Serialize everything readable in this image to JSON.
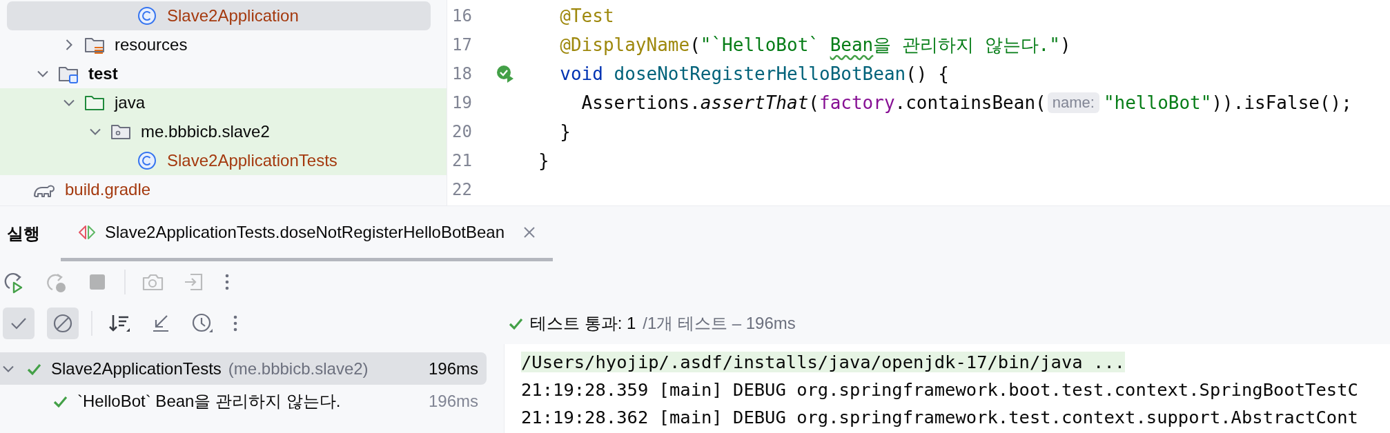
{
  "project_tree": {
    "items": [
      {
        "children": [
          {
            "children": [
              {
                "children": [
                  {
                    "children": [
                      {
                        "label": "Slave2Application",
                        "kind": "class",
                        "selected": true,
                        "highlighted": false,
                        "color": "#a4390e"
                      }
                    ]
                  }
                ]
              },
              {
                "label": "resources",
                "kind": "resources-folder",
                "expanded": false,
                "selected": false,
                "highlighted": false,
                "color": "#080808"
              }
            ]
          },
          {
            "label": "test",
            "kind": "test-folder",
            "expanded": true,
            "selected": false,
            "highlighted": false,
            "color": "#080808",
            "children": [
              {
                "label": "java",
                "kind": "source-folder",
                "expanded": true,
                "selected": false,
                "highlighted": true,
                "color": "#080808",
                "children": [
                  {
                    "label": "me.bbbicb.slave2",
                    "kind": "package",
                    "expanded": true,
                    "selected": false,
                    "highlighted": true,
                    "color": "#080808",
                    "children": [
                      {
                        "label": "Slave2ApplicationTests",
                        "kind": "class",
                        "selected": false,
                        "highlighted": true,
                        "color": "#a4390e"
                      }
                    ]
                  }
                ]
              }
            ]
          }
        ]
      },
      {
        "label": "build.gradle",
        "kind": "gradle",
        "selected": false,
        "highlighted": false,
        "color": "#a4390e"
      }
    ]
  },
  "editor": {
    "lines": [
      {
        "children": [
          {
            "number": "16",
            "tokens": [
              {
                "kind": "annotation",
                "text": "@Test"
              }
            ]
          },
          {
            "number": "17",
            "tokens": [
              {
                "kind": "annotation",
                "text": "@DisplayName"
              },
              {
                "kind": "plain",
                "text": "("
              },
              {
                "kind": "string",
                "text": "\"`HelloBot` "
              },
              {
                "kind": "string",
                "text": "Bean",
                "typo": true
              },
              {
                "kind": "string",
                "text": "을 관리하지 않는다.\""
              },
              {
                "kind": "plain",
                "text": ")"
              }
            ]
          },
          {
            "number": "18",
            "run_marker": true,
            "tokens": [
              {
                "kind": "keyword",
                "text": "void"
              },
              {
                "kind": "method",
                "text": " doseNotRegisterHelloBotBean"
              },
              {
                "kind": "plain",
                "text": "() {"
              }
            ],
            "children": [
              {
                "number": "19",
                "tokens": [
                  {
                    "kind": "plain",
                    "text": "Assertions."
                  },
                  {
                    "kind": "static-call",
                    "text": "assertThat"
                  },
                  {
                    "kind": "plain",
                    "text": "("
                  },
                  {
                    "kind": "field",
                    "text": "factory"
                  },
                  {
                    "kind": "plain",
                    "text": ".containsBean("
                  },
                  {
                    "kind": "hint",
                    "text": "name:"
                  },
                  {
                    "kind": "string",
                    "text": "\"helloBot\""
                  },
                  {
                    "kind": "plain",
                    "text": ")).isFalse();"
                  }
                ]
              }
            ]
          },
          {
            "number": "20",
            "tokens": [
              {
                "kind": "plain",
                "text": "}"
              }
            ]
          }
        ]
      },
      {
        "number": "21",
        "tokens": [
          {
            "kind": "plain",
            "text": "}"
          }
        ]
      },
      {
        "number": "22"
      }
    ]
  },
  "run_panel": {
    "title": "실행",
    "tab": {
      "label": "Slave2ApplicationTests.doseNotRegisterHelloBotBean",
      "selected": true
    },
    "toolbar": [
      {
        "kind": "rerun",
        "disabled": false
      },
      {
        "kind": "rerun-failed",
        "disabled": true
      },
      {
        "kind": "stop",
        "disabled": true
      },
      {
        "kind": "separator"
      },
      {
        "kind": "screenshot",
        "disabled": true
      },
      {
        "kind": "export",
        "disabled": true
      },
      {
        "kind": "more",
        "disabled": false
      }
    ],
    "filter_toolbar": [
      {
        "kind": "show-passed",
        "toggled": true
      },
      {
        "kind": "show-ignored",
        "toggled": true
      },
      {
        "kind": "separator"
      },
      {
        "kind": "sort",
        "toggled": false
      },
      {
        "kind": "collapse",
        "toggled": false
      },
      {
        "kind": "history",
        "toggled": false
      },
      {
        "kind": "more",
        "toggled": false
      }
    ],
    "status": {
      "passed": true,
      "summary": "테스트 통과: 1",
      "detail": "/1개 테스트 – 196ms"
    },
    "tests": [
      {
        "label": "Slave2ApplicationTests",
        "package": "(me.bbbicb.slave2)",
        "duration": "196ms",
        "passed": true,
        "expanded": true,
        "selected": true,
        "children": [
          {
            "label": "`HelloBot` Bean을 관리하지 않는다.",
            "duration": "196ms",
            "passed": true,
            "selected": false
          }
        ]
      }
    ],
    "console": [
      {
        "text": "/Users/hyojip/.asdf/installs/java/openjdk-17/bin/java ...",
        "kind": "command"
      },
      {
        "text": "21:19:28.359 [main] DEBUG org.springframework.boot.test.context.SpringBootTestC",
        "kind": "log"
      },
      {
        "text": "21:19:28.362 [main] DEBUG org.springframework.test.context.support.AbstractCont",
        "kind": "log"
      }
    ]
  }
}
